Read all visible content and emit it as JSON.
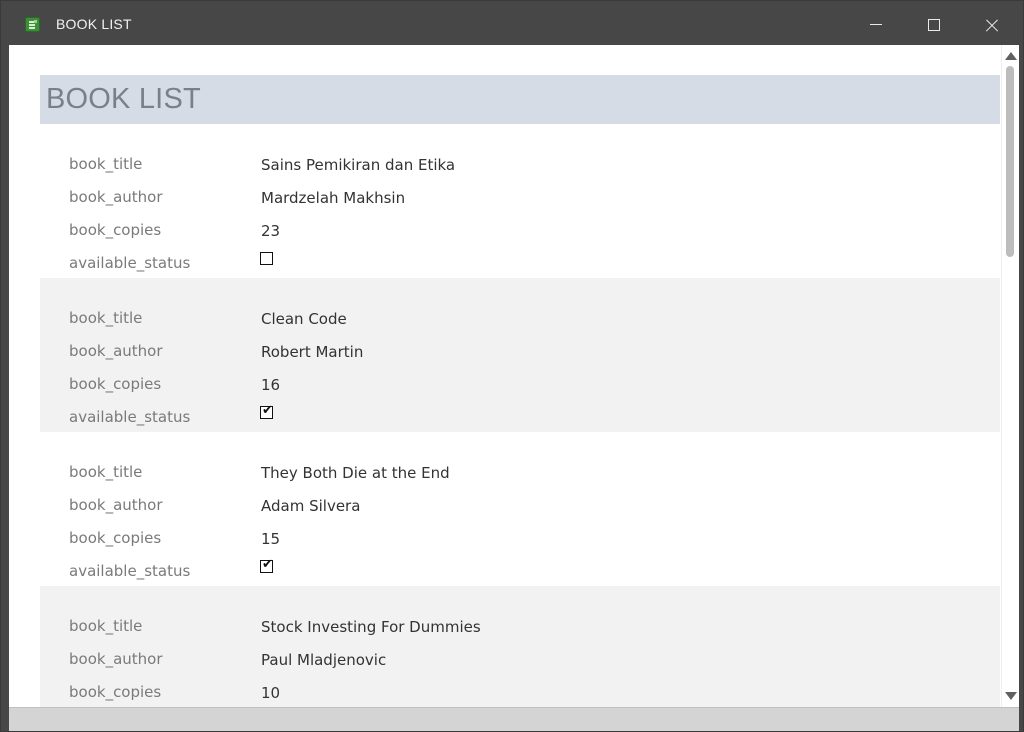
{
  "window": {
    "title": "BOOK LIST",
    "icon": "access-report-icon",
    "controls": [
      "minimize-icon",
      "maximize-icon",
      "close-icon"
    ]
  },
  "report": {
    "title": "BOOK LIST"
  },
  "labels": {
    "book_title": "book_title",
    "book_author": "book_author",
    "book_copies": "book_copies",
    "available_status": "available_status"
  },
  "records": [
    {
      "book_title": "Sains Pemikiran dan Etika",
      "book_author": "Mardzelah Makhsin",
      "book_copies": "23",
      "available_status": false
    },
    {
      "book_title": "Clean Code",
      "book_author": "Robert Martin",
      "book_copies": "16",
      "available_status": true
    },
    {
      "book_title": "They Both Die at the End",
      "book_author": "Adam Silvera",
      "book_copies": "15",
      "available_status": true
    },
    {
      "book_title": "Stock Investing For Dummies",
      "book_author": "Paul Mladjenovic",
      "book_copies": "10"
    }
  ],
  "colors": {
    "titlebar": "#474747",
    "header_band": "#d6dce5",
    "alt_row": "#f2f2f2",
    "label_text": "#7a7a7a",
    "value_text": "#333333"
  }
}
